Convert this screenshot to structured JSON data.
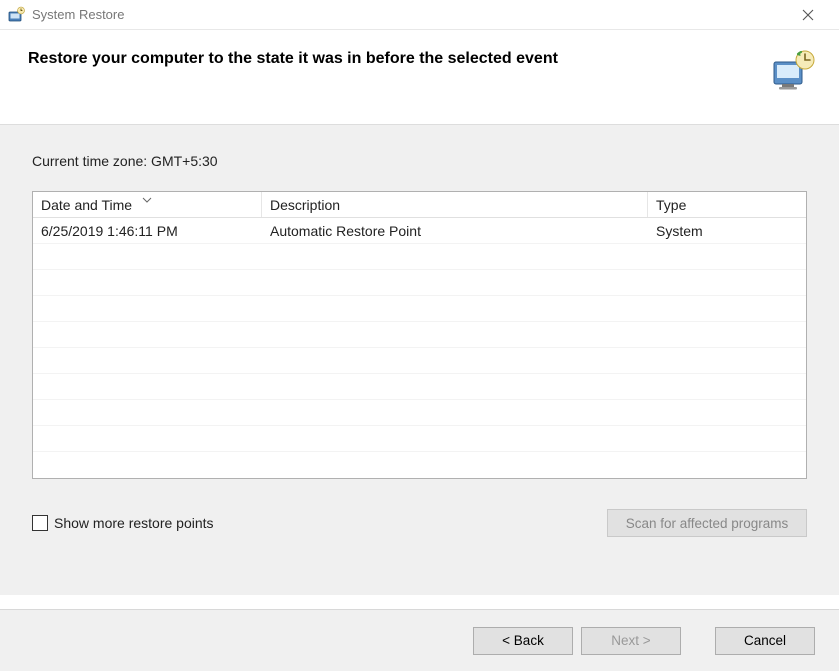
{
  "window": {
    "title": "System Restore"
  },
  "header": {
    "title": "Restore your computer to the state it was in before the selected event"
  },
  "content": {
    "timezone_label": "Current time zone: GMT+5:30",
    "columns": {
      "date": "Date and Time",
      "desc": "Description",
      "type": "Type"
    },
    "rows": [
      {
        "date": "6/25/2019 1:46:11 PM",
        "desc": "Automatic Restore Point",
        "type": "System"
      }
    ],
    "checkbox_label": "Show more restore points",
    "scan_button": "Scan for affected programs"
  },
  "footer": {
    "back": "< Back",
    "next": "Next >",
    "cancel": "Cancel"
  }
}
